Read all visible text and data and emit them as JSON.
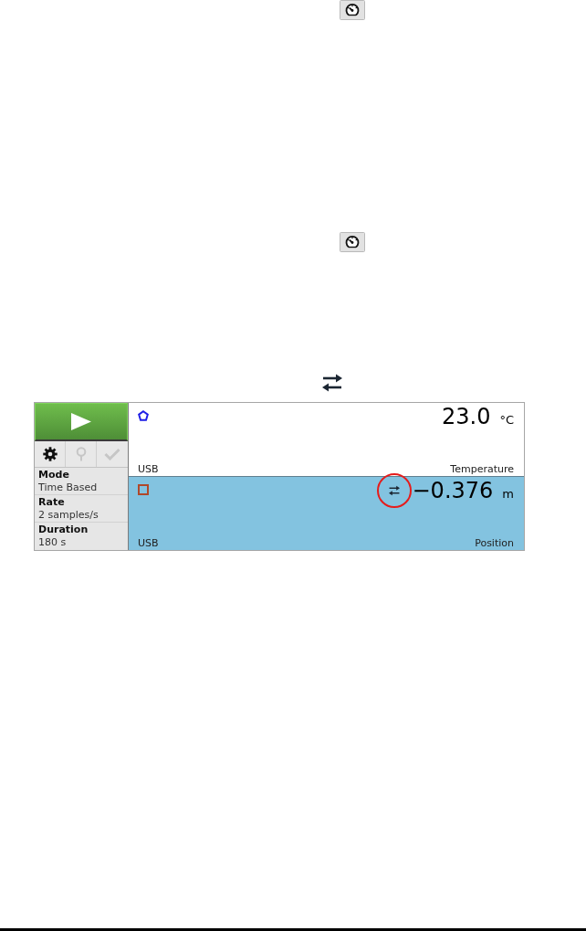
{
  "tools": [
    {
      "kind": "settings",
      "disabled": false
    },
    {
      "kind": "marker",
      "disabled": true
    },
    {
      "kind": "check",
      "disabled": true
    }
  ],
  "settings": [
    {
      "label": "Mode",
      "value": "Time Based"
    },
    {
      "label": "Rate",
      "value": "2 samples/s"
    },
    {
      "label": "Duration",
      "value": "180 s"
    }
  ],
  "meters": [
    {
      "kind": "pentagon",
      "color": "#1f1fe6",
      "value": "23.0",
      "unit": "°C",
      "source": "USB",
      "sensor": "Temperature",
      "selected": false,
      "reverse_button": false,
      "circled": false
    },
    {
      "kind": "square",
      "color": "#b0482a",
      "value": "−0.376",
      "unit": "m",
      "source": "USB",
      "sensor": "Position",
      "selected": true,
      "reverse_button": true,
      "circled": true
    }
  ]
}
